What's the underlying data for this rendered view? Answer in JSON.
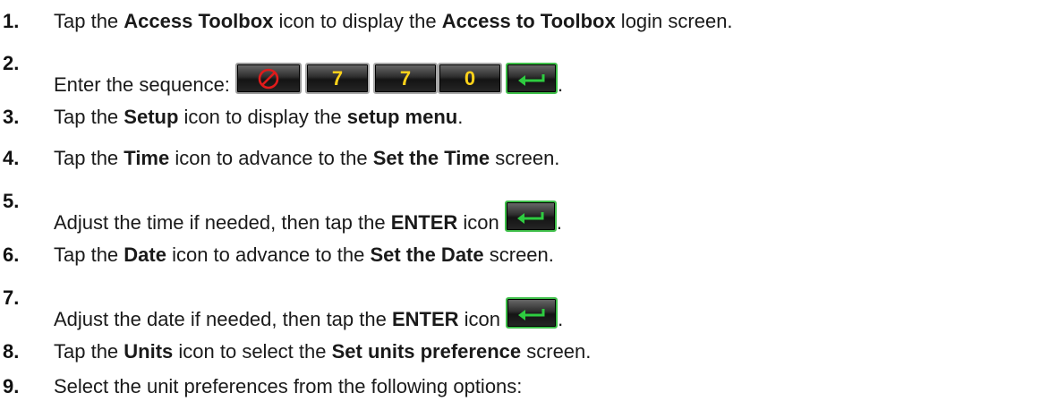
{
  "steps": [
    {
      "num": "1.",
      "parts": [
        "Tap the ",
        "Access Toolbox",
        " icon to display the ",
        "Access to Toolbox",
        " login screen."
      ]
    },
    {
      "num": "2.",
      "parts": [
        "Enter the sequence: ",
        "."
      ],
      "sequence": [
        "cancel",
        "7",
        "7",
        "0",
        "enter"
      ]
    },
    {
      "num": "3.",
      "parts": [
        "Tap the ",
        "Setup",
        " icon to display the ",
        "setup menu",
        "."
      ]
    },
    {
      "num": "4.",
      "parts": [
        "Tap the ",
        "Time",
        " icon to advance to the ",
        "Set the Time",
        " screen."
      ]
    },
    {
      "num": "5.",
      "parts": [
        "Adjust the time if needed, then tap the ",
        "ENTER",
        " icon ",
        "."
      ]
    },
    {
      "num": "6.",
      "parts": [
        "Tap the ",
        "Date",
        " icon to advance to the ",
        "Set the Date",
        " screen."
      ]
    },
    {
      "num": "7.",
      "parts": [
        "Adjust the date if needed, then tap the ",
        "ENTER",
        " icon ",
        "."
      ]
    },
    {
      "num": "8.",
      "parts": [
        "Tap the ",
        "Units",
        " icon to select the ",
        "Set units preference",
        " screen."
      ]
    },
    {
      "num": "9.",
      "parts": [
        "Select the unit preferences from the following options:"
      ]
    }
  ],
  "key_colors": {
    "digit_text": "#ffd21a",
    "cancel_icon": "#e01b1b",
    "enter_icon": "#2ecc40"
  }
}
